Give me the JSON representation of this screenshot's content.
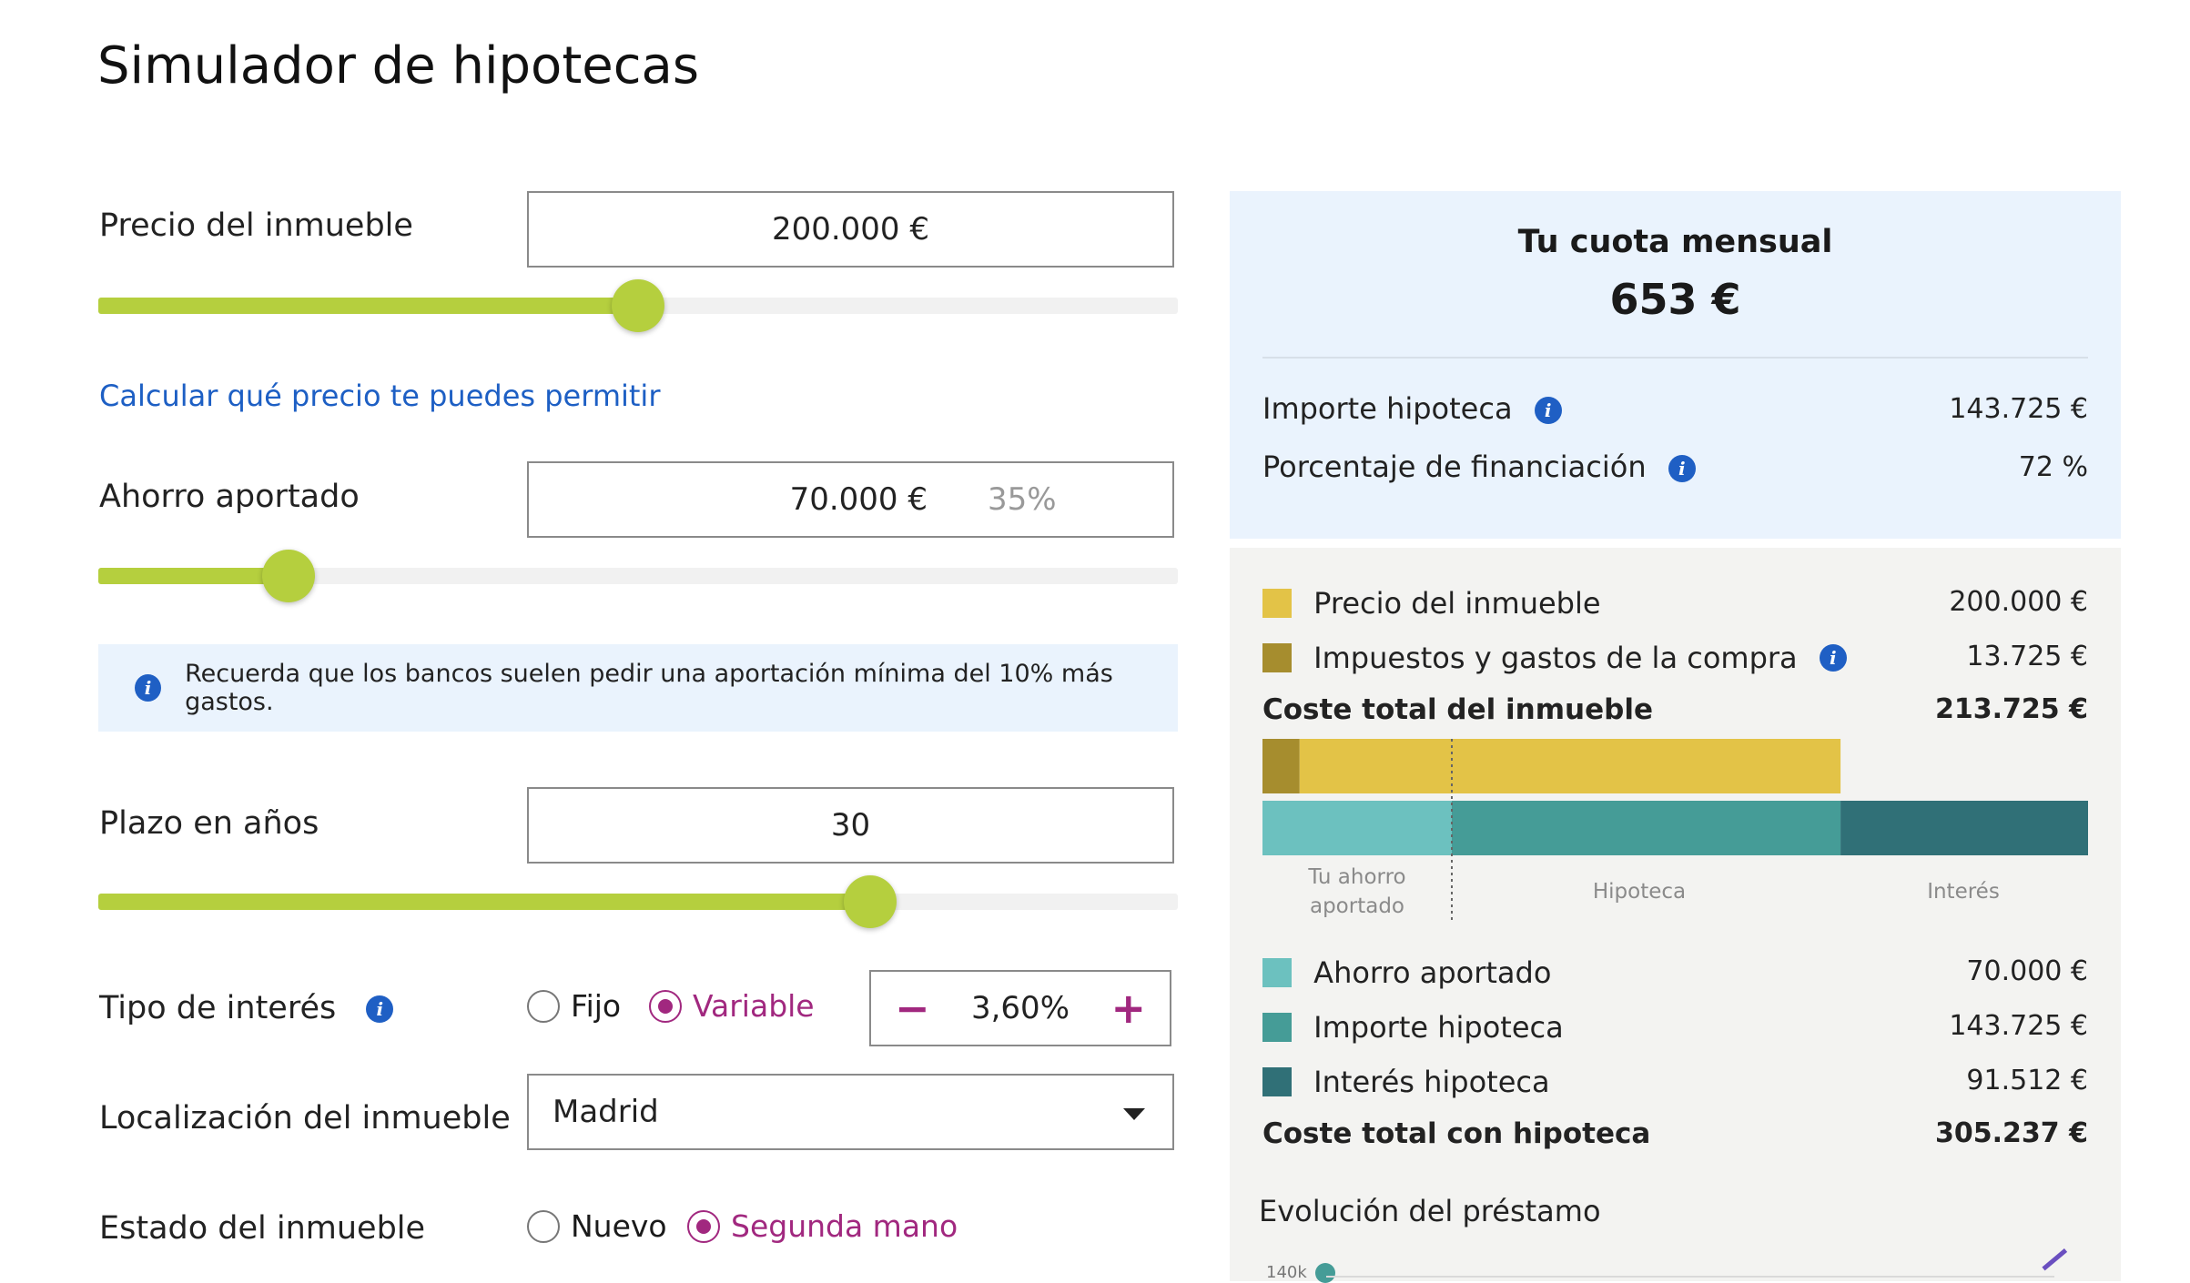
{
  "page": {
    "title": "Simulador de hipotecas"
  },
  "precio": {
    "label": "Precio del inmueble",
    "value": "200.000 €",
    "slider_fraction": 0.5
  },
  "link_permitir": "Calcular qué precio te puedes permitir",
  "ahorro": {
    "label": "Ahorro aportado",
    "value": "70.000 €",
    "percent": "35%",
    "slider_fraction": 0.176
  },
  "note": {
    "text": "Recuerda que los bancos suelen pedir una aportación mínima del 10% más gastos.",
    "icon": "info-icon"
  },
  "plazo": {
    "label": "Plazo en años",
    "value": "30",
    "slider_fraction": 0.715
  },
  "interes": {
    "label": "Tipo de interés",
    "options": [
      "Fijo",
      "Variable"
    ],
    "selected": "Variable",
    "rate": "3,60%",
    "minus": "−",
    "plus": "+"
  },
  "localizacion": {
    "label": "Localización del inmueble",
    "value": "Madrid"
  },
  "estado": {
    "label": "Estado del inmueble",
    "options": [
      "Nuevo",
      "Segunda mano"
    ],
    "selected": "Segunda mano"
  },
  "summary": {
    "cuota_label": "Tu cuota mensual",
    "cuota_value": "653 €",
    "importe_label": "Importe hipoteca",
    "importe_value": "143.725 €",
    "financiacion_label": "Porcentaje de financiación",
    "financiacion_value": "72 %"
  },
  "breakdown": {
    "precio_label": "Precio del inmueble",
    "precio_value": "200.000 €",
    "impuestos_label": "Impuestos y gastos de la compra",
    "impuestos_value": "13.725 €",
    "coste_inmueble_label": "Coste total del inmueble",
    "coste_inmueble_value": "213.725 €",
    "ahorro_label": "Ahorro aportado",
    "ahorro_value": "70.000 €",
    "hipoteca_label": "Importe hipoteca",
    "hipoteca_value": "143.725 €",
    "interes_label": "Interés hipoteca",
    "interes_value": "91.512 €",
    "coste_hipoteca_label": "Coste total con hipoteca",
    "coste_hipoteca_value": "305.237 €",
    "axis_ahorro": "Tu ahorro aportado",
    "axis_hipoteca": "Hipoteca",
    "axis_interes": "Interés",
    "evolucion_label": "Evolución del préstamo",
    "evolucion_tick": "140k"
  },
  "chart_data": {
    "type": "bar",
    "stacked": true,
    "categories": [
      "Coste total del inmueble",
      "Coste total con hipoteca"
    ],
    "series": [
      {
        "name": "Impuestos y gastos de la compra",
        "values": [
          13725,
          0
        ],
        "color": "#a68d2e"
      },
      {
        "name": "Precio del inmueble",
        "values": [
          200000,
          0
        ],
        "color": "#e3c347"
      },
      {
        "name": "Ahorro aportado",
        "values": [
          0,
          70000
        ],
        "color": "#6cc1bf"
      },
      {
        "name": "Importe hipoteca",
        "values": [
          0,
          143725
        ],
        "color": "#459c97"
      },
      {
        "name": "Interés hipoteca",
        "values": [
          0,
          91512
        ],
        "color": "#307077"
      }
    ],
    "total": 305237
  }
}
